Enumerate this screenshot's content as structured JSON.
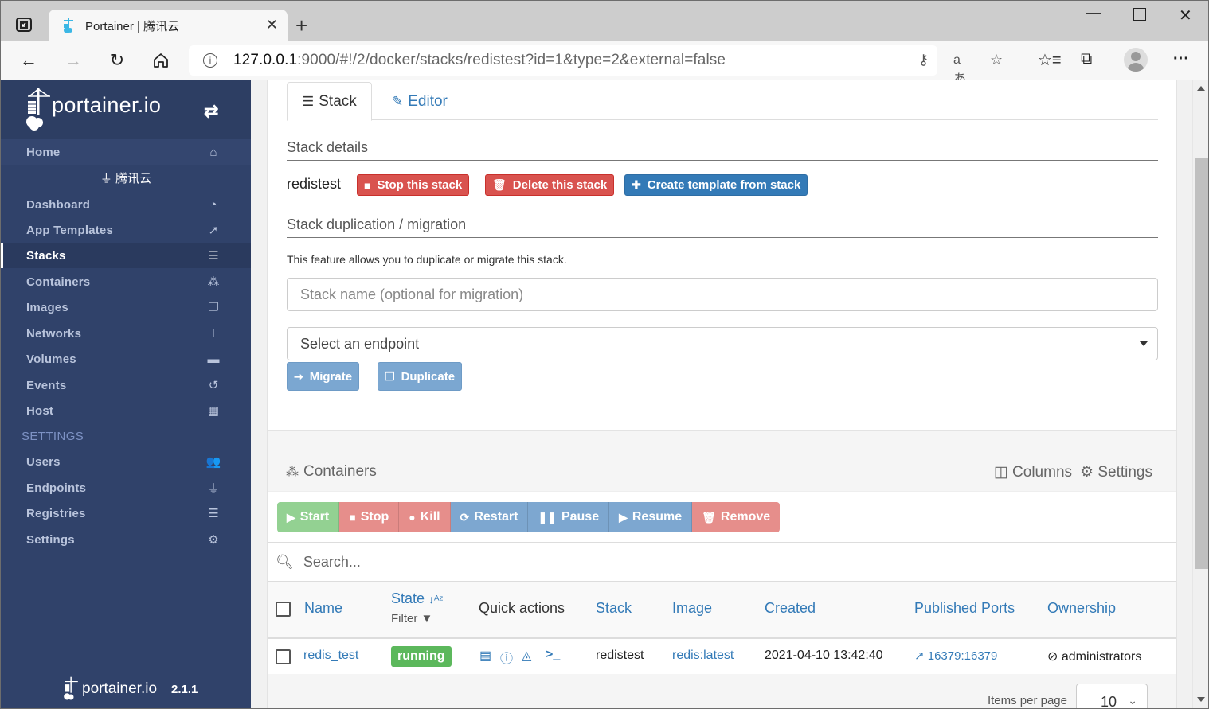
{
  "browser": {
    "tab_title": "Portainer | 腾讯云",
    "url_host": "127.0.0.1",
    "url_rest": ":9000/#!/2/docker/stacks/redistest?id=1&type=2&external=false",
    "icons": [
      "tab-actions-icon",
      "portainer-favicon",
      "close-tab-icon",
      "new-tab-icon",
      "minimize-icon",
      "maximize-icon",
      "close-window-icon",
      "back-icon",
      "forward-icon",
      "refresh-icon",
      "home-icon",
      "site-info-icon",
      "password-key-icon",
      "read-aloud-translate-icon",
      "add-favorite-icon",
      "favorites-icon",
      "collections-icon",
      "profile-avatar",
      "more-menu-icon"
    ]
  },
  "sidebar": {
    "logo_text": "portainer.io",
    "home": {
      "label": "Home",
      "icon": "home-icon"
    },
    "endpoint_name": "腾讯云",
    "items": [
      {
        "label": "Dashboard",
        "icon": "tachometer-icon"
      },
      {
        "label": "App Templates",
        "icon": "rocket-icon"
      },
      {
        "label": "Stacks",
        "icon": "th-list-icon",
        "active": true
      },
      {
        "label": "Containers",
        "icon": "cubes-icon"
      },
      {
        "label": "Images",
        "icon": "clone-icon"
      },
      {
        "label": "Networks",
        "icon": "sitemap-icon"
      },
      {
        "label": "Volumes",
        "icon": "hdd-icon"
      },
      {
        "label": "Events",
        "icon": "history-icon"
      },
      {
        "label": "Host",
        "icon": "th-icon"
      }
    ],
    "settings_section": "SETTINGS",
    "settings_items": [
      {
        "label": "Users",
        "icon": "users-icon"
      },
      {
        "label": "Endpoints",
        "icon": "plug-icon"
      },
      {
        "label": "Registries",
        "icon": "database-icon"
      },
      {
        "label": "Settings",
        "icon": "cogs-icon"
      }
    ],
    "footer_logo": "portainer.io",
    "version": "2.1.1"
  },
  "stack_panel": {
    "tabs": [
      {
        "label": "Stack",
        "active": true
      },
      {
        "label": "Editor",
        "active": false
      }
    ],
    "details_title": "Stack details",
    "stack_name": "redistest",
    "buttons": {
      "stop": "Stop this stack",
      "delete": "Delete this stack",
      "create_template": "Create template from stack"
    },
    "migration_title": "Stack duplication / migration",
    "migration_help": "This feature allows you to duplicate or migrate this stack.",
    "stack_name_input": {
      "value": "",
      "placeholder": "Stack name (optional for migration)"
    },
    "endpoint_select": {
      "selected": "Select an endpoint"
    },
    "migrate_label": "Migrate",
    "duplicate_label": "Duplicate"
  },
  "containers_panel": {
    "title": "Containers",
    "columns_label": "Columns",
    "settings_label": "Settings",
    "actions": [
      {
        "label": "Start",
        "color": "#93d192"
      },
      {
        "label": "Stop",
        "color": "#e68e8b"
      },
      {
        "label": "Kill",
        "color": "#e68e8b"
      },
      {
        "label": "Restart",
        "color": "#7da7d0"
      },
      {
        "label": "Pause",
        "color": "#7da7d0"
      },
      {
        "label": "Resume",
        "color": "#7da7d0"
      },
      {
        "label": "Remove",
        "color": "#e68e8b"
      }
    ],
    "search_placeholder": "Search...",
    "headers": {
      "name": "Name",
      "state": "State",
      "filter": "Filter",
      "quick_actions": "Quick actions",
      "stack": "Stack",
      "image": "Image",
      "created": "Created",
      "ports": "Published Ports",
      "ownership": "Ownership"
    },
    "rows": [
      {
        "name": "redis_test",
        "state": "running",
        "stack": "redistest",
        "image": "redis:latest",
        "created": "2021-04-10 13:42:40",
        "ports": "16379:16379",
        "ownership": "administrators"
      }
    ],
    "items_per_page_label": "Items per page",
    "items_per_page": "10"
  },
  "colors": {
    "sidebar_bg": "#30426a",
    "danger": "#d9534f",
    "primary": "#337ab7",
    "success": "#5cb85c",
    "link": "#337ab7"
  }
}
